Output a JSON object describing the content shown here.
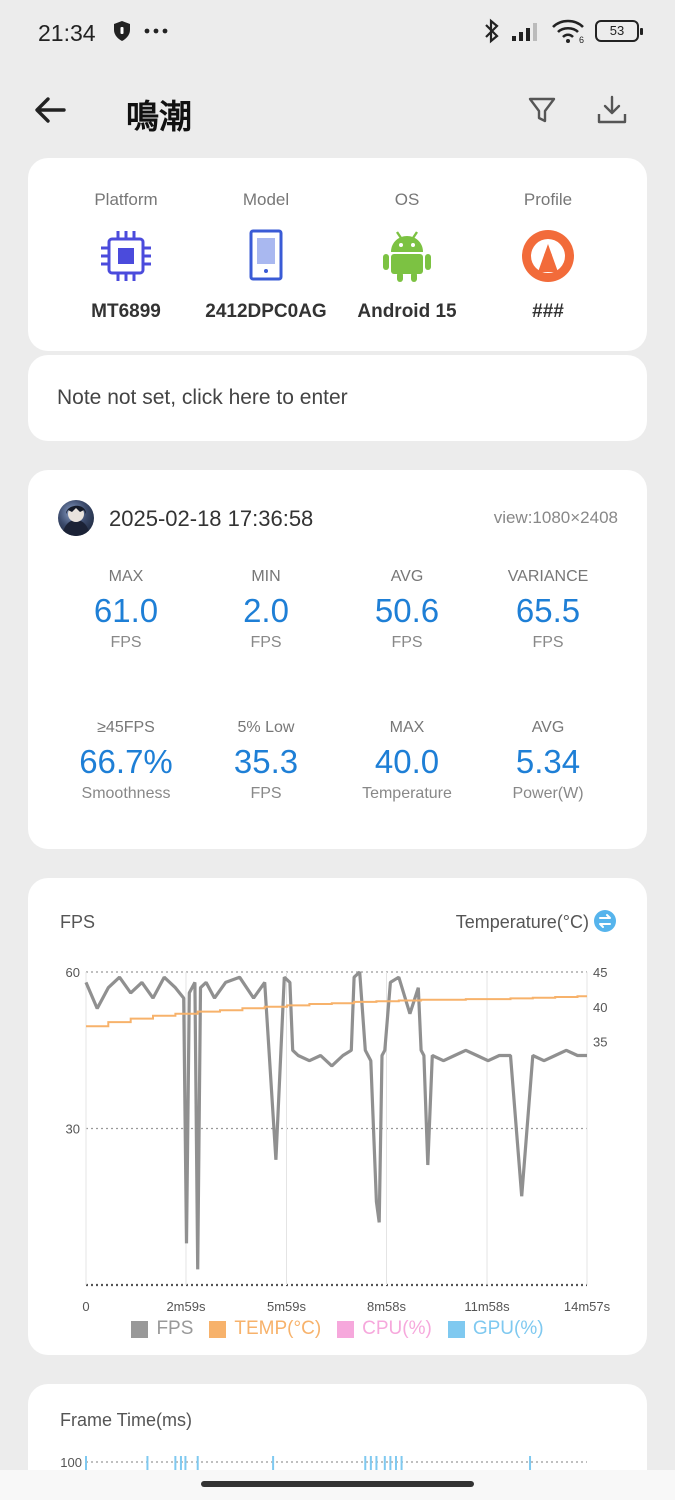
{
  "status": {
    "time": "21:34",
    "battery": "53",
    "signal_sub": "6"
  },
  "appbar": {
    "title": "鳴潮"
  },
  "device": [
    {
      "label": "Platform",
      "value": "MT6899",
      "icon": "chip-icon"
    },
    {
      "label": "Model",
      "value": "2412DPC0AG",
      "icon": "phone-icon"
    },
    {
      "label": "OS",
      "value": "Android 15",
      "icon": "android-icon"
    },
    {
      "label": "Profile",
      "value": "###",
      "icon": "profile-icon"
    }
  ],
  "note": {
    "text": "Note not set, click here to enter"
  },
  "session": {
    "datetime": "2025-02-18 17:36:58",
    "view": "view:1080×2408"
  },
  "stats": [
    {
      "top": "MAX",
      "value": "61.0",
      "bottom": "FPS"
    },
    {
      "top": "MIN",
      "value": "2.0",
      "bottom": "FPS"
    },
    {
      "top": "AVG",
      "value": "50.6",
      "bottom": "FPS"
    },
    {
      "top": "VARIANCE",
      "value": "65.5",
      "bottom": "FPS"
    },
    {
      "top": "≥45FPS",
      "value": "66.7%",
      "bottom": "Smoothness"
    },
    {
      "top": "5% Low",
      "value": "35.3",
      "bottom": "FPS"
    },
    {
      "top": "MAX",
      "value": "40.0",
      "bottom": "Temperature"
    },
    {
      "top": "AVG",
      "value": "5.34",
      "bottom": "Power(W)"
    }
  ],
  "colors": {
    "accent": "#1e7fd6",
    "fps": "#8a8a8a",
    "temp": "#f7b26b",
    "cpu": "#f6a8dc",
    "gpu": "#7fc9f0"
  },
  "chart_data": {
    "type": "line",
    "left_title": "FPS",
    "right_title": "Temperature(°C)",
    "x_ticks": [
      "0",
      "2m59s",
      "5m59s",
      "8m58s",
      "11m58s",
      "14m57s"
    ],
    "x_tick_seconds": [
      0,
      179,
      359,
      538,
      718,
      897
    ],
    "x_range_seconds": [
      0,
      897
    ],
    "y_left_ticks": [
      "60",
      "30"
    ],
    "y_left_range": [
      0,
      60
    ],
    "y_right_ticks": [
      "45",
      "40",
      "35"
    ],
    "y_right_range": [
      0,
      45
    ],
    "grid": true,
    "legend_position": "bottom",
    "legend": [
      "FPS",
      "TEMP(°C)",
      "CPU(%)",
      "GPU(%)"
    ],
    "series": [
      {
        "name": "FPS",
        "x": [
          0,
          20,
          40,
          60,
          80,
          100,
          120,
          140,
          160,
          175,
          180,
          185,
          195,
          200,
          205,
          215,
          230,
          250,
          275,
          300,
          320,
          340,
          355,
          365,
          370,
          380,
          400,
          420,
          440,
          460,
          475,
          480,
          490,
          500,
          510,
          520,
          525,
          530,
          535,
          545,
          560,
          580,
          595,
          600,
          605,
          612,
          620,
          640,
          660,
          680,
          700,
          720,
          740,
          760,
          780,
          800,
          820,
          840,
          860,
          880,
          897
        ],
        "y": [
          58,
          53,
          57,
          59,
          56,
          58,
          55,
          59,
          57,
          55,
          8,
          56,
          58,
          3,
          57,
          58,
          55,
          58,
          59,
          55,
          58,
          24,
          59,
          58,
          45,
          44,
          43,
          44,
          42,
          44,
          45,
          59,
          60,
          45,
          43,
          16,
          12,
          44,
          45,
          58,
          59,
          52,
          57,
          45,
          44,
          23,
          44,
          43,
          44,
          45,
          44,
          43,
          44,
          44,
          17,
          44,
          43,
          44,
          45,
          44,
          44
        ]
      },
      {
        "name": "TEMP(°C)",
        "x": [
          0,
          40,
          80,
          120,
          160,
          200,
          240,
          280,
          320,
          360,
          400,
          440,
          480,
          520,
          560,
          600,
          640,
          680,
          720,
          760,
          800,
          840,
          880,
          897
        ],
        "y": [
          37.2,
          37.8,
          38.3,
          38.7,
          39.0,
          39.3,
          39.5,
          39.8,
          40.0,
          40.2,
          40.4,
          40.5,
          40.7,
          40.8,
          40.9,
          41.0,
          41.0,
          41.1,
          41.1,
          41.2,
          41.3,
          41.4,
          41.5,
          41.5
        ]
      }
    ]
  },
  "frame_chart": {
    "title": "Frame Time(ms)",
    "y_tick": "100",
    "spikes_seconds": [
      0,
      110,
      160,
      170,
      178,
      200,
      335,
      500,
      510,
      520,
      535,
      545,
      555,
      565,
      795
    ]
  }
}
